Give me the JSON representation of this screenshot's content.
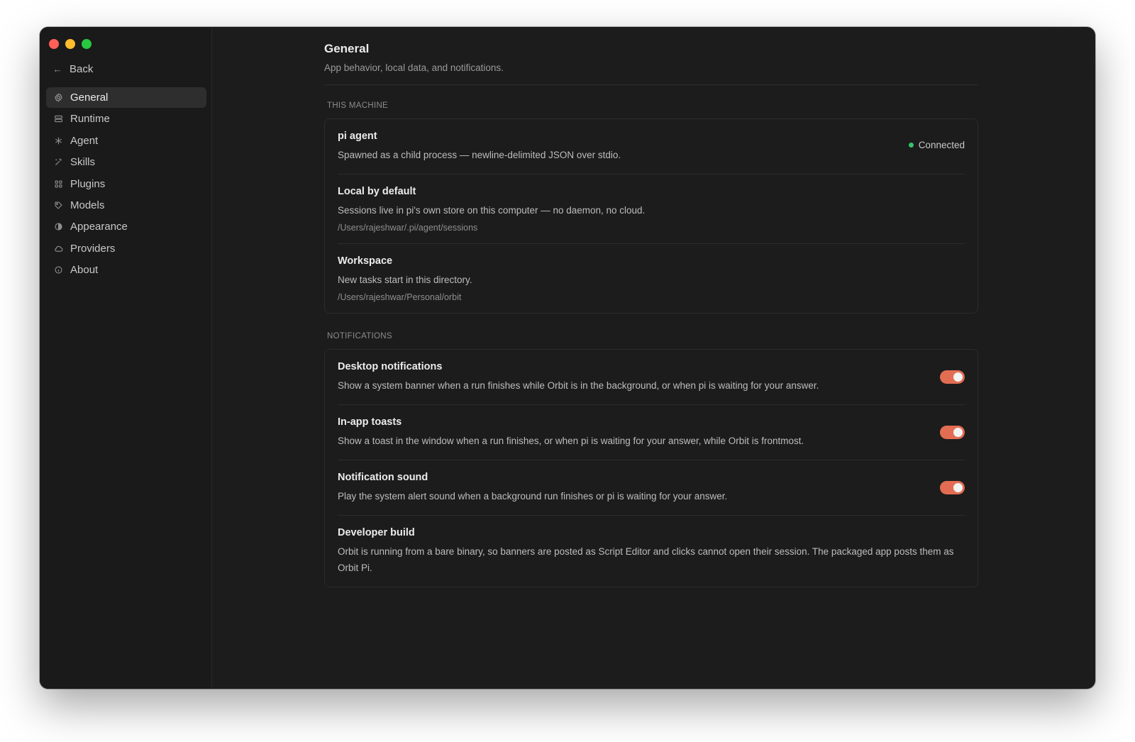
{
  "sidebar": {
    "back_label": "Back",
    "items": [
      {
        "label": "General",
        "icon": "gear-icon",
        "active": true
      },
      {
        "label": "Runtime",
        "icon": "server-icon"
      },
      {
        "label": "Agent",
        "icon": "asterisk-icon"
      },
      {
        "label": "Skills",
        "icon": "wand-icon"
      },
      {
        "label": "Plugins",
        "icon": "grid-icon"
      },
      {
        "label": "Models",
        "icon": "tag-icon"
      },
      {
        "label": "Appearance",
        "icon": "contrast-icon"
      },
      {
        "label": "Providers",
        "icon": "cloud-icon"
      },
      {
        "label": "About",
        "icon": "info-icon"
      }
    ]
  },
  "header": {
    "title": "General",
    "subtitle": "App behavior, local data, and notifications."
  },
  "this_machine": {
    "label": "THIS MACHINE",
    "rows": [
      {
        "title": "pi agent",
        "desc": "Spawned as a child process — newline-delimited JSON over stdio.",
        "status": "Connected"
      },
      {
        "title": "Local by default",
        "desc": "Sessions live in pi's own store on this computer — no daemon, no cloud.",
        "path": "/Users/rajeshwar/.pi/agent/sessions"
      },
      {
        "title": "Workspace",
        "desc": "New tasks start in this directory.",
        "path": "/Users/rajeshwar/Personal/orbit"
      }
    ]
  },
  "notifications": {
    "label": "NOTIFICATIONS",
    "rows": [
      {
        "title": "Desktop notifications",
        "desc": "Show a system banner when a run finishes while Orbit is in the background, or when pi is waiting for your answer.",
        "enabled": true
      },
      {
        "title": "In-app toasts",
        "desc": "Show a toast in the window when a run finishes, or when pi is waiting for your answer, while Orbit is frontmost.",
        "enabled": true
      },
      {
        "title": "Notification sound",
        "desc": "Play the system alert sound when a background run finishes or pi is waiting for your answer.",
        "enabled": true
      },
      {
        "title": "Developer build",
        "desc": "Orbit is running from a bare binary, so banners are posted as Script Editor and clicks cannot open their session. The packaged app posts them as Orbit Pi."
      }
    ]
  },
  "colors": {
    "accent": "#e26d52",
    "status_ok": "#35c46a",
    "background": "#1c1c1c"
  }
}
